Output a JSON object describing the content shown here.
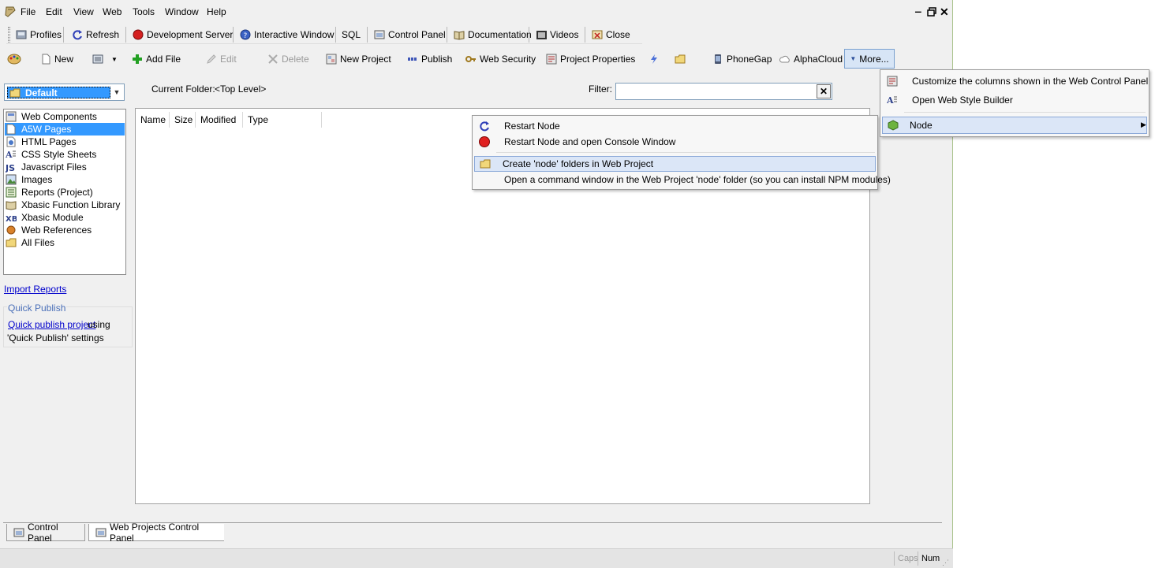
{
  "menu": [
    "File",
    "Edit",
    "View",
    "Web",
    "Tools",
    "Window",
    "Help"
  ],
  "toolbar1": {
    "profiles": "Profiles",
    "refresh": "Refresh",
    "dev_server": "Development Server",
    "interactive": "Interactive Window",
    "sql": "SQL",
    "control_panel": "Control Panel",
    "documentation": "Documentation",
    "videos": "Videos",
    "close": "Close"
  },
  "toolbar2": {
    "new": "New",
    "add_file": "Add File",
    "edit": "Edit",
    "delete": "Delete",
    "new_project": "New Project",
    "publish": "Publish",
    "web_security": "Web Security",
    "project_properties": "Project Properties",
    "phonegap": "PhoneGap",
    "alphacloud": "AlphaCloud",
    "more": "More..."
  },
  "combo": {
    "selected": "Default"
  },
  "current_folder": {
    "label": "Current Folder:",
    "value": "<Top Level>"
  },
  "filter": {
    "label": "Filter:",
    "value": ""
  },
  "tree": [
    "Web Components",
    "A5W Pages",
    "HTML Pages",
    "CSS Style Sheets",
    "Javascript Files",
    "Images",
    "Reports (Project)",
    "Xbasic Function Library",
    "Xbasic Module",
    "Web References",
    "All Files"
  ],
  "tree_selected_index": 1,
  "import_reports": "Import Reports",
  "quick_publish": {
    "title": "Quick Publish",
    "link": "Quick publish project",
    "text1": "using",
    "text2": "'Quick Publish' settings"
  },
  "columns": [
    "Name",
    "Size",
    "Modified",
    "Type"
  ],
  "more_menu": {
    "customize": "Customize the columns shown in the Web Control Panel",
    "style_builder": "Open Web Style Builder",
    "node": "Node"
  },
  "node_menu": {
    "restart": "Restart Node",
    "restart_console": "Restart Node and open Console Window",
    "create_folders": "Create 'node' folders in Web Project",
    "open_cmd": "Open a command window in the Web Project 'node' folder (so you can install NPM modules)"
  },
  "bottom_tabs": {
    "control_panel": "Control Panel",
    "web_projects": "Web Projects Control Panel"
  },
  "status": {
    "caps": "Caps",
    "num": "Num"
  }
}
